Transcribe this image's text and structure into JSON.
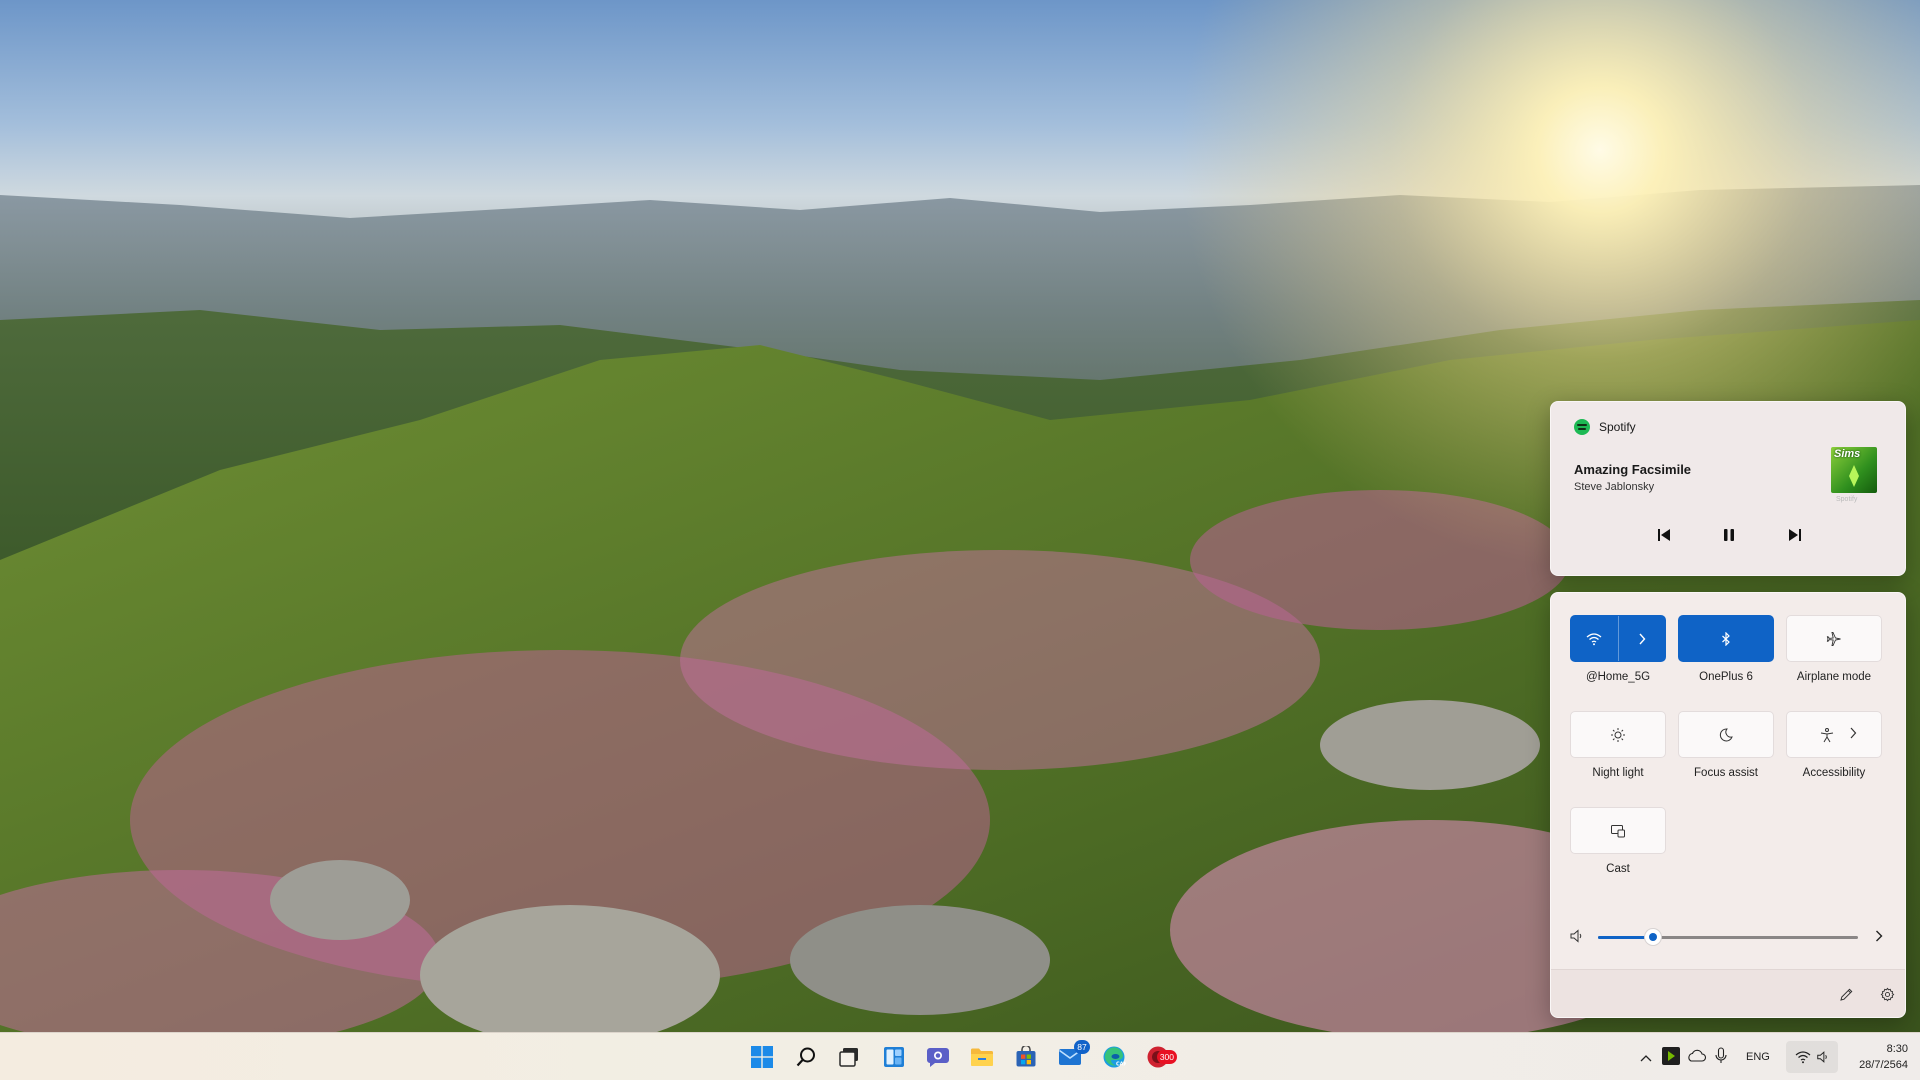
{
  "colors": {
    "accent": "#0f63c6",
    "spotify_green": "#1db954"
  },
  "media": {
    "app_name": "Spotify",
    "app_icon": "spotify-icon",
    "track_title": "Amazing Facsimile",
    "artist": "Steve Jablonsky",
    "album_art_text": "Sims",
    "album_art_caption": "Spotify",
    "controls": [
      "previous-icon",
      "pause-icon",
      "next-icon"
    ]
  },
  "quick_settings": {
    "tiles": [
      {
        "label": "@Home_5G",
        "icon": "wifi-icon",
        "active": true,
        "has_arrow": true
      },
      {
        "label": "OnePlus 6",
        "icon": "bluetooth-icon",
        "active": true
      },
      {
        "label": "Airplane mode",
        "icon": "airplane-icon",
        "active": false
      },
      {
        "label": "Night light",
        "icon": "brightness-icon",
        "active": false
      },
      {
        "label": "Focus assist",
        "icon": "moon-icon",
        "active": false
      },
      {
        "label": "Accessibility",
        "icon": "accessibility-icon",
        "active": false,
        "has_arrow": true
      },
      {
        "label": "Cast",
        "icon": "cast-icon",
        "active": false
      }
    ],
    "volume": {
      "level_fraction": 0.21,
      "icon": "speaker-icon"
    },
    "footer": [
      "edit-pencil-icon",
      "settings-gear-icon"
    ]
  },
  "taskbar": {
    "pinned": [
      {
        "name": "start",
        "icon": "windows-logo-icon"
      },
      {
        "name": "search",
        "icon": "search-icon"
      },
      {
        "name": "task-view",
        "icon": "task-view-icon"
      },
      {
        "name": "widgets",
        "icon": "widgets-icon"
      },
      {
        "name": "chat",
        "icon": "teams-chat-icon"
      },
      {
        "name": "file-explorer",
        "icon": "folder-icon"
      },
      {
        "name": "store",
        "icon": "store-icon"
      },
      {
        "name": "mail",
        "icon": "mail-icon",
        "badge": "87"
      },
      {
        "name": "edge",
        "icon": "edge-icon"
      },
      {
        "name": "app-300",
        "icon": "app-icon",
        "badge": "300"
      }
    ],
    "tray": {
      "language": "ENG",
      "time": "8:30",
      "date": "28/7/2564"
    }
  }
}
